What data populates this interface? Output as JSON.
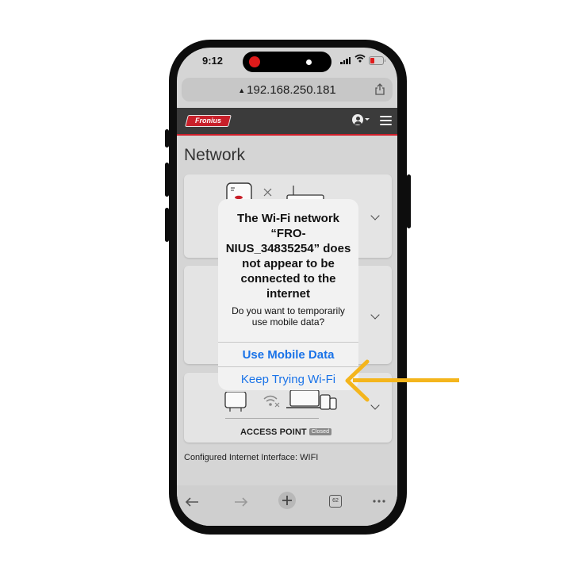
{
  "status_bar": {
    "time": "9:12"
  },
  "browser": {
    "url": "192.168.250.181",
    "toolbar_icons": [
      "back-arrow-icon",
      "forward-arrow-icon",
      "new-tab-plus-icon",
      "tabs-count-icon",
      "more-dots-icon"
    ],
    "tab_count": "62"
  },
  "app": {
    "logo_text": "Fronius",
    "page_title": "Network",
    "access_point": {
      "label": "ACCESS POINT",
      "badge": "Closed"
    },
    "configured_interface": "Configured Internet Interface: WIFI"
  },
  "dialog": {
    "title": "The Wi-Fi network “FRO-NIUS_34835254” does not appear to be connected to the internet",
    "message": "Do you want to temporarily use mobile data?",
    "primary_button": "Use Mobile Data",
    "secondary_button": "Keep Trying Wi-Fi"
  },
  "colors": {
    "accent_red": "#cf1f2a",
    "link_blue": "#1a73e8",
    "annotation_arrow": "#f4b51c",
    "phone_frame": "#0d0d0d"
  }
}
